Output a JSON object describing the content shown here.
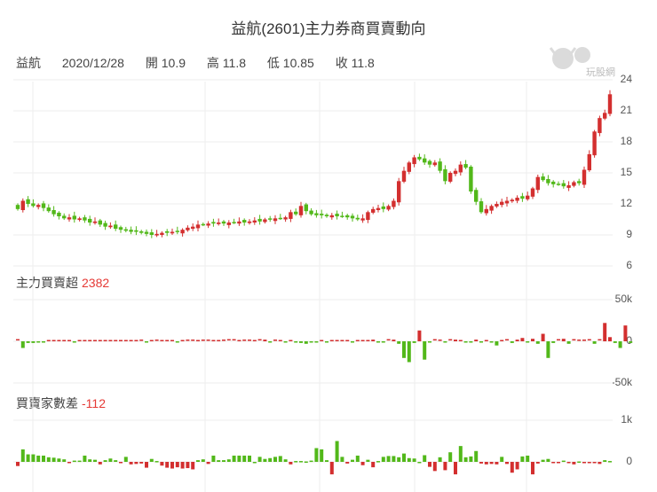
{
  "title": "益航(2601)主力券商買賣動向",
  "info": {
    "name": "益航",
    "date": "2020/12/28",
    "open_label": "開 10.9",
    "high_label": "高 11.8",
    "low_label": "低 10.85",
    "close_label": "收 11.8"
  },
  "logo_text": "玩股網",
  "colors": {
    "up": "#d32f2f",
    "down": "#52b81a",
    "grid": "#eeeeee"
  },
  "panels": {
    "main_force": {
      "label": "主力買賣超",
      "value": "2382"
    },
    "broker_diff": {
      "label": "買賣家數差",
      "value": "-112"
    }
  },
  "chart_data": [
    {
      "type": "candlestick",
      "name": "price",
      "yticks": [
        "24",
        "21",
        "18",
        "15",
        "12",
        "9",
        "6"
      ],
      "ylim": [
        6,
        24
      ],
      "close": [
        11.5,
        12.3,
        12.0,
        11.8,
        11.9,
        11.6,
        11.3,
        11.0,
        10.8,
        10.6,
        10.7,
        10.5,
        10.6,
        10.4,
        10.2,
        10.3,
        10.0,
        9.8,
        9.9,
        9.6,
        9.5,
        9.4,
        9.3,
        9.3,
        9.2,
        9.1,
        9.0,
        9.1,
        9.2,
        9.2,
        9.3,
        9.3,
        9.5,
        9.7,
        9.8,
        10.0,
        10.0,
        10.1,
        10.1,
        10.2,
        10.1,
        10.2,
        10.2,
        10.3,
        10.2,
        10.3,
        10.4,
        10.3,
        10.5,
        10.5,
        10.6,
        10.6,
        10.7,
        11.2,
        11.0,
        11.8,
        11.3,
        11.0,
        10.9,
        10.9,
        10.8,
        10.9,
        10.8,
        10.8,
        10.7,
        10.6,
        10.5,
        10.6,
        11.2,
        11.5,
        11.6,
        11.5,
        11.8,
        12.3,
        14.2,
        15.2,
        16.0,
        16.5,
        16.3,
        16.0,
        15.8,
        16.0,
        15.2,
        14.2,
        15.0,
        15.2,
        15.8,
        15.5,
        13.2,
        12.2,
        11.2,
        11.5,
        11.8,
        12.0,
        12.2,
        12.3,
        12.4,
        12.6,
        12.5,
        12.8,
        13.5,
        14.6,
        14.3,
        14.0,
        13.9,
        13.9,
        13.7,
        13.8,
        14.1,
        14.0,
        15.3,
        16.8,
        19.0,
        20.3,
        20.8,
        22.6
      ]
    },
    {
      "type": "bar",
      "name": "main_force",
      "yticks": [
        "50k",
        "0",
        "-50k"
      ],
      "ylim": [
        -50,
        50
      ],
      "unit": "k",
      "values": [
        1,
        -8,
        -2,
        -2,
        -1,
        -1,
        0,
        0,
        0,
        0,
        0,
        -0.5,
        0,
        0,
        0,
        0,
        0,
        0,
        0,
        0,
        0,
        0,
        0,
        0,
        0.5,
        -0.5,
        0,
        0.5,
        0,
        0,
        0,
        -0.5,
        0,
        0.5,
        0.5,
        0,
        0.5,
        0.5,
        0,
        0,
        0.5,
        1,
        1,
        0,
        0.5,
        0.5,
        0,
        1,
        2,
        -1,
        0.5,
        0,
        -0.5,
        0,
        -0.5,
        -2,
        -3,
        -1,
        -0.5,
        0,
        -0.5,
        0,
        0,
        0,
        0,
        -0.5,
        0,
        0,
        0,
        2,
        -1,
        -1,
        1,
        2,
        -3,
        -20,
        -25,
        -2,
        13,
        -22,
        -1,
        1,
        0.5,
        -0.5,
        1,
        2,
        0,
        -1,
        -1,
        2,
        -1,
        0,
        -1,
        -5,
        0,
        1,
        -2,
        2,
        4,
        -1,
        3,
        -3,
        9,
        -20,
        -2,
        1,
        3,
        -3,
        1,
        0.5,
        0.5,
        1,
        -3,
        1,
        22,
        5,
        -2,
        -8,
        19,
        -2
      ]
    },
    {
      "type": "bar",
      "name": "broker_diff",
      "yticks": [
        "1k",
        "0"
      ],
      "ylim": [
        -700,
        1000
      ],
      "values": [
        -100,
        300,
        180,
        180,
        150,
        150,
        110,
        100,
        80,
        60,
        -20,
        30,
        30,
        150,
        60,
        50,
        -60,
        40,
        80,
        40,
        -30,
        120,
        -60,
        -50,
        -40,
        -140,
        70,
        20,
        -90,
        -140,
        -160,
        -130,
        -160,
        -150,
        -180,
        40,
        60,
        -50,
        150,
        40,
        40,
        60,
        150,
        150,
        150,
        150,
        0,
        120,
        70,
        90,
        120,
        140,
        60,
        -60,
        20,
        20,
        10,
        30,
        330,
        300,
        40,
        -300,
        500,
        120,
        -40,
        50,
        150,
        -80,
        50,
        -130,
        20,
        120,
        140,
        140,
        110,
        200,
        90,
        80,
        0,
        160,
        -120,
        -220,
        110,
        -200,
        230,
        -300,
        380,
        110,
        130,
        260,
        -40,
        -60,
        -50,
        -60,
        120,
        -50,
        -260,
        -180,
        130,
        150,
        -300,
        -40,
        50,
        70,
        -20,
        -10,
        30,
        -20,
        -60,
        10,
        -20,
        -30,
        -30,
        -50,
        40,
        20
      ]
    }
  ]
}
